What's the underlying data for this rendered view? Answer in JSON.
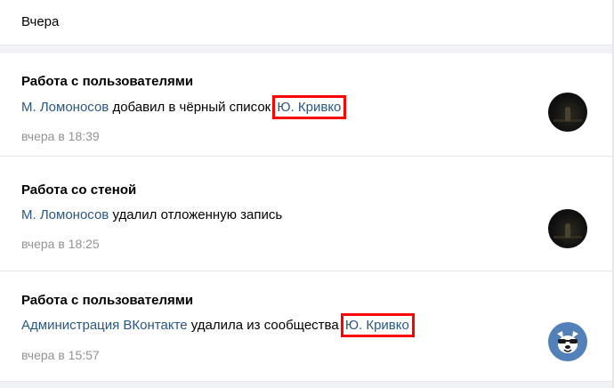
{
  "day_header": "Вчера",
  "entries": [
    {
      "title": "Работа с пользователями",
      "actor": "М. Ломоносов",
      "action": "добавил в чёрный список",
      "target": "Ю. Кривко",
      "time": "вчера в 18:39",
      "avatar": "user-photo"
    },
    {
      "title": "Работа со стеной",
      "actor": "М. Ломоносов",
      "action": "удалил отложенную запись",
      "time": "вчера в 18:25",
      "avatar": "user-photo"
    },
    {
      "title": "Работа с пользователями",
      "actor": "Администрация ВКонтакте",
      "action": "удалила из сообщества",
      "target": "Ю. Кривко",
      "time": "вчера в 15:57",
      "avatar": "vk-dog-logo"
    }
  ],
  "colors": {
    "link": "#2a5885",
    "highlight_border": "#ff0000",
    "secondary_text": "#939393",
    "vk_avatar_bg": "#5181b8"
  }
}
